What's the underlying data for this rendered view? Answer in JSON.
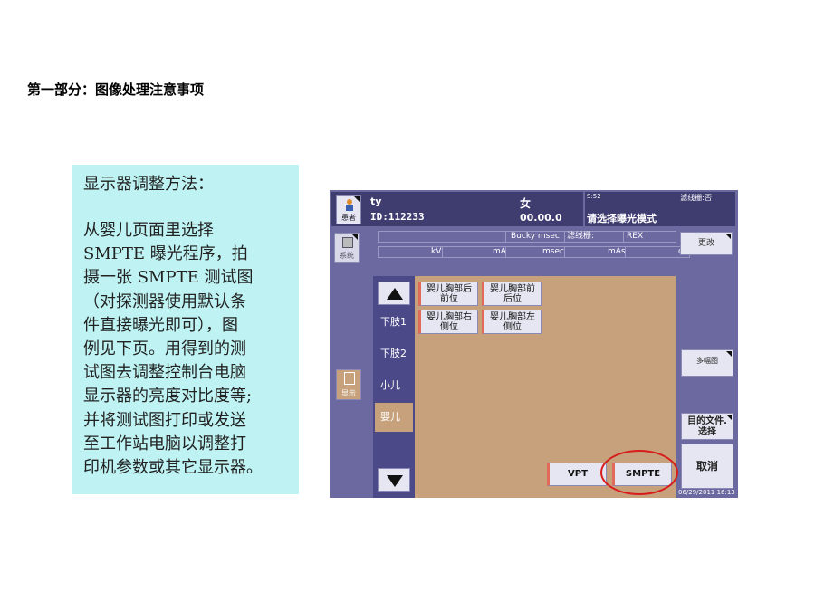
{
  "slide": {
    "title": "第一部分：图像处理注意事项",
    "note_heading": "显示器调整方法：",
    "note_lines": [
      "从婴儿页面里选择",
      "SMPTE 曝光程序，拍",
      "摄一张 SMPTE 测试图",
      "（对探测器使用默认条",
      "件直接曝光即可），图",
      "例见下页。用得到的测",
      "试图去调整控制台电脑",
      "显示器的亮度对比度等;",
      "并将测试图打印或发送",
      "至工作站电脑以调整打",
      "印机参数或其它显示器。"
    ]
  },
  "ui": {
    "patient": {
      "button_label": "患者",
      "name": "ty",
      "id": "ID:112233",
      "sex": "女",
      "dob": "00.00.0"
    },
    "status": {
      "small": "S:52",
      "grid": "滤线栅:否",
      "message": "请选择曝光模式"
    },
    "system_label": "系统",
    "params_top": {
      "bucky": "Bucky msec",
      "grid": "滤线栅:",
      "rex": "REX :"
    },
    "params_bottom": {
      "kv": "kV",
      "ma": "mA",
      "msec": "msec",
      "mas": "mAs",
      "cm": "cm"
    },
    "change_label": "更改",
    "categories": [
      "下肢1",
      "下肢2",
      "小儿",
      "婴儿"
    ],
    "protocols": [
      {
        "line1": "婴儿胸部后",
        "line2": "前位"
      },
      {
        "line1": "婴儿胸部前",
        "line2": "后位"
      },
      {
        "line1": "婴儿胸部右",
        "line2": "侧位"
      },
      {
        "line1": "婴儿胸部左",
        "line2": "侧位"
      }
    ],
    "bottom_buttons": {
      "vpt": "VPT",
      "smpte": "SMPTE"
    },
    "left_icon_label": "显示",
    "right_buttons": {
      "multi": "多幅图",
      "dest_line1": "目的文件.",
      "dest_line2": "选择",
      "cancel": "取消"
    },
    "timestamp": "06/29/2011 16:13"
  }
}
